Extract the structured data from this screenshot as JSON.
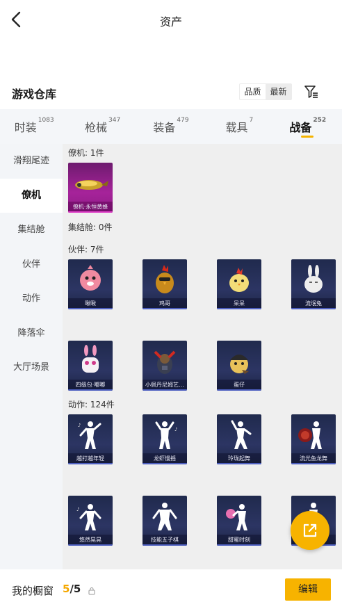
{
  "topbar": {
    "title": "资产"
  },
  "header": {
    "title": "游戏仓库",
    "sort_options": [
      "品质",
      "最新"
    ]
  },
  "tabs": [
    {
      "label": "时装",
      "count": "1083"
    },
    {
      "label": "枪械",
      "count": "347"
    },
    {
      "label": "装备",
      "count": "479"
    },
    {
      "label": "载具",
      "count": "7"
    },
    {
      "label": "战备",
      "count": "252",
      "active": true
    }
  ],
  "sidebar": {
    "items": [
      "滑翔尾迹",
      "僚机",
      "集结舱",
      "伙伴",
      "动作",
      "降落伞",
      "大厅场景"
    ],
    "active_index": 1
  },
  "sections": [
    {
      "title": "僚机: 1件",
      "items": [
        "僚机·永恒黄蜂"
      ]
    },
    {
      "title": "集结舱: 0件",
      "items": []
    },
    {
      "title": "伙伴: 7件",
      "items": [
        "啾啾",
        "鸡哥",
        "呆呆",
        "流氓兔",
        "四级包·嘟嘟",
        "小佩丹尼姆艺…",
        "蛋仔"
      ]
    },
    {
      "title": "动作: 124件",
      "items": [
        "越打越年轻",
        "龙虾慢摇",
        "玲珑起舞",
        "流光鱼龙舞",
        "悠然晃晃",
        "技能五子棋",
        "甜蜜时刻",
        ""
      ]
    }
  ],
  "fab": {
    "icon": "share-external-icon"
  },
  "bottom": {
    "label": "我的橱窗",
    "current": "5",
    "separator": "/",
    "total": "5",
    "edit_label": "编辑"
  },
  "colors": {
    "accent": "#f7b300",
    "card_dark": "#202a4d",
    "card_purple": "#a6239a"
  }
}
